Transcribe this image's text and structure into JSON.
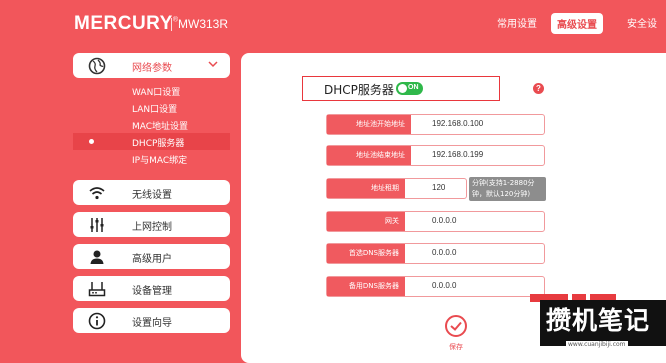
{
  "header": {
    "brand": "MERCURY",
    "trademark": "®",
    "model": "MW313R",
    "nav": [
      "常用设置",
      "高级设置",
      "安全设"
    ]
  },
  "sidebar": {
    "group": {
      "label": "网络参数",
      "icon": "globe-icon"
    },
    "subitems": [
      "WAN口设置",
      "LAN口设置",
      "MAC地址设置",
      "DHCP服务器",
      "IP与MAC绑定"
    ],
    "active_index": 3,
    "cards": [
      {
        "label": "无线设置",
        "icon": "wifi-icon"
      },
      {
        "label": "上网控制",
        "icon": "sliders-icon"
      },
      {
        "label": "高级用户",
        "icon": "user-icon"
      },
      {
        "label": "设备管理",
        "icon": "router-icon"
      },
      {
        "label": "设置向导",
        "icon": "info-icon"
      }
    ]
  },
  "main": {
    "title": "DHCP服务器",
    "toggle": "ON",
    "help": "?",
    "fields": [
      {
        "label": "地址池开始地址",
        "value": "192.168.0.100"
      },
      {
        "label": "地址池结束地址",
        "value": "192.168.0.199"
      },
      {
        "label": "地址租期",
        "value": "120"
      },
      {
        "label": "网关",
        "value": "0.0.0.0"
      },
      {
        "label": "首选DNS服务器",
        "value": "0.0.0.0"
      },
      {
        "label": "备用DNS服务器",
        "value": "0.0.0.0"
      }
    ],
    "lease_hint": "分钟(支持1-2880分钟，默认120分钟)",
    "save_label": "保存"
  },
  "watermark": {
    "text": "攒机笔记",
    "url": "www.cuanjibiji.com"
  },
  "colors": {
    "brand_red": "#f2565b",
    "accent": "#e94b50",
    "toggle_green": "#2fb84a"
  }
}
